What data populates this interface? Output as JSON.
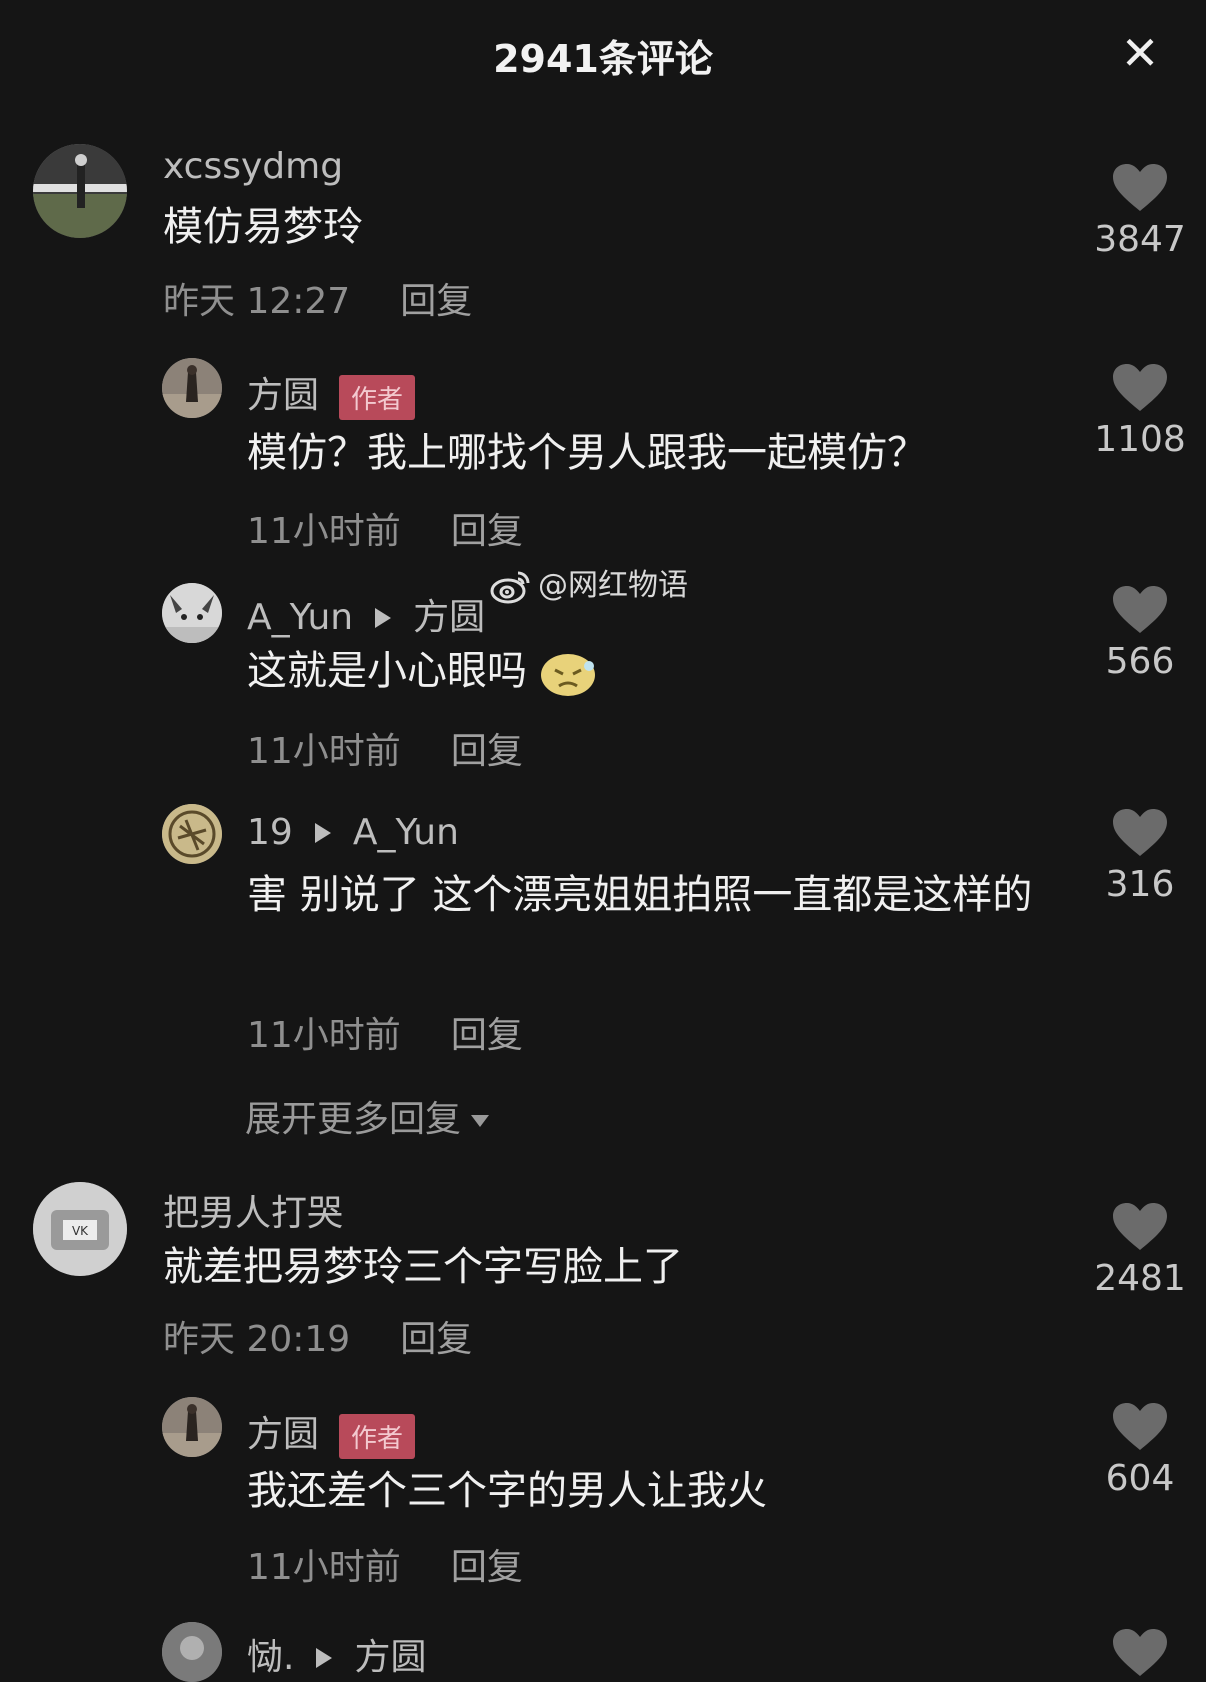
{
  "header": {
    "title": "2941条评论"
  },
  "watermark": "@网红物语",
  "comments": [
    {
      "user": "xcssydmg",
      "text": "模仿易梦玲",
      "time": "昨天 12:27",
      "reply": "回复",
      "likes": "3847"
    },
    {
      "user": "方圆",
      "badge": "作者",
      "text": "模仿？我上哪找个男人跟我一起模仿？",
      "time": "11小时前",
      "reply": "回复",
      "likes": "1108"
    },
    {
      "user": "A_Yun",
      "reply_to": "方圆",
      "text": "这就是小心眼吗",
      "time": "11小时前",
      "reply": "回复",
      "likes": "566"
    },
    {
      "user": "19",
      "reply_to": "A_Yun",
      "text": "害 别说了 这个漂亮姐姐拍照一直都是这样的",
      "time": "11小时前",
      "reply": "回复",
      "likes": "316"
    },
    {
      "user": "把男人打哭",
      "text": "就差把易梦玲三个字写脸上了",
      "time": "昨天 20:19",
      "reply": "回复",
      "likes": "2481"
    },
    {
      "user": "方圆",
      "badge": "作者",
      "text": "我还差个三个字的男人让我火",
      "time": "11小时前",
      "reply": "回复",
      "likes": "604"
    },
    {
      "user": "恸.",
      "reply_to": "方圆"
    }
  ],
  "expand_replies": "展开更多回复"
}
